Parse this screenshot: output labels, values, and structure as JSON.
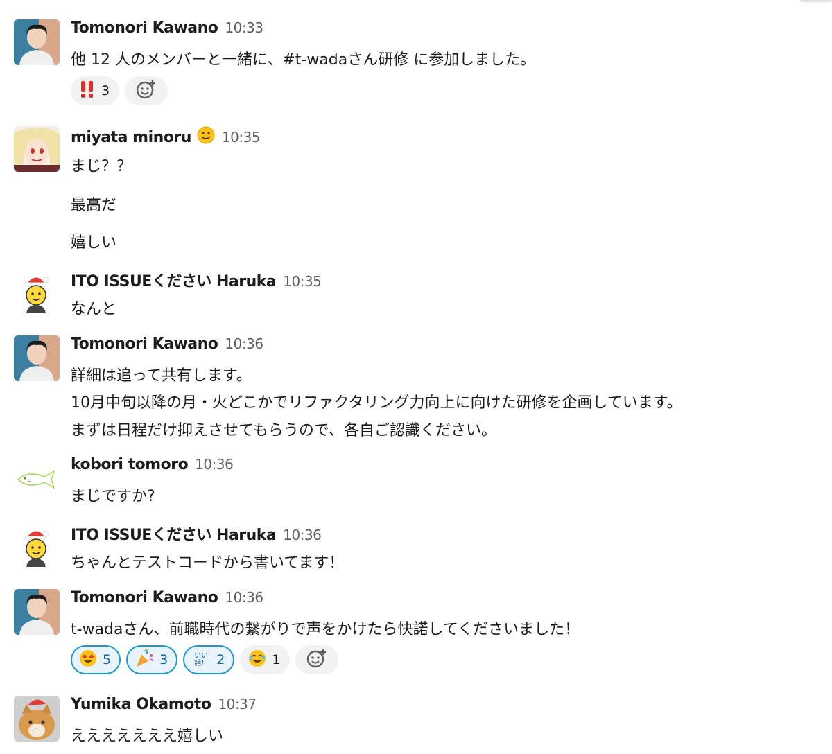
{
  "messages": [
    {
      "author": "Tomonori Kawano",
      "time": "10:33",
      "lines": [
        "他 12 人のメンバーと一緒に、#t-wadaさん研修 に参加しました。"
      ],
      "reactions": [
        {
          "emoji": "double-exclamation",
          "count": "3"
        }
      ]
    },
    {
      "author": "miyata minoru",
      "time": "10:35",
      "lines": [
        "まじ？？",
        "最高だ",
        "嬉しい"
      ]
    },
    {
      "author": "ITO ISSUEください Haruka",
      "time": "10:35",
      "lines": [
        "なんと"
      ]
    },
    {
      "author": "Tomonori Kawano",
      "time": "10:36",
      "lines": [
        "詳細は追って共有します。",
        "10月中旬以降の月・火どこかでリファクタリング力向上に向けた研修を企画しています。",
        "まずは日程だけ抑えさせてもらうので、各自ご認識ください。"
      ]
    },
    {
      "author": "kobori tomoro",
      "time": "10:36",
      "lines": [
        "まじですか?"
      ]
    },
    {
      "author": "ITO ISSUEください Haruka",
      "time": "10:36",
      "lines": [
        "ちゃんとテストコードから書いてます！"
      ]
    },
    {
      "author": "Tomonori Kawano",
      "time": "10:36",
      "lines": [
        "t-wadaさん、前職時代の繋がりで声をかけたら快諾してくださいました！"
      ],
      "reactions": [
        {
          "emoji": "heart-eyes",
          "count": "5"
        },
        {
          "emoji": "party-popper",
          "count": "3"
        },
        {
          "emoji": "ii-hanashi",
          "label": "いい話！",
          "count": "2"
        },
        {
          "emoji": "joy",
          "count": "1"
        }
      ]
    },
    {
      "author": "Yumika Okamoto",
      "time": "10:37",
      "lines": [
        "えええええええ嬉しい"
      ]
    }
  ]
}
